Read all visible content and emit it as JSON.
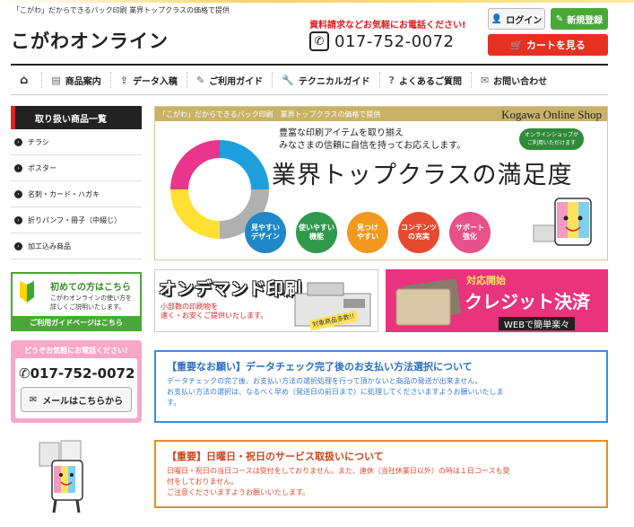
{
  "header": {
    "tagline": "「こがわ」だからできるパック印刷 業界トップクラスの価格で提供",
    "logo": "こがわオンライン",
    "request_text": "資料請求などお気軽にお電話ください!",
    "phone": "017-752-0072",
    "login_label": "ログイン",
    "signup_label": "新規登録",
    "cart_label": "カートを見る"
  },
  "nav": {
    "items": [
      {
        "label": "",
        "icon": "home-icon"
      },
      {
        "label": "商品案内",
        "icon": "document-icon"
      },
      {
        "label": "データ入稿",
        "icon": "upload-icon"
      },
      {
        "label": "ご利用ガイド",
        "icon": "pencil-icon"
      },
      {
        "label": "テクニカルガイド",
        "icon": "wrench-icon"
      },
      {
        "label": "よくあるご質問",
        "icon": "question-icon"
      },
      {
        "label": "お問い合わせ",
        "icon": "mail-icon"
      }
    ]
  },
  "sidebar": {
    "heading": "取り扱い商品一覧",
    "items": [
      {
        "label": "チラシ"
      },
      {
        "label": "ポスター"
      },
      {
        "label": "名刺・カード・ハガキ"
      },
      {
        "label": "折りパンフ・冊子（中綴じ）"
      },
      {
        "label": "加工込み商品"
      }
    ],
    "guide": {
      "title": "初めての方はこちら",
      "desc1": "こがわオンラインの使い方を",
      "desc2": "詳しくご説明いたします。",
      "button": "ご利用ガイドページはこちら"
    },
    "contact": {
      "title": "どうぞお気軽にお電話ください!",
      "phone": "017-752-0072",
      "mail_button": "メールはこちらから"
    }
  },
  "hero": {
    "strip_left": "「こがわ」だからできるパック印刷　業界トップクラスの価格で提供",
    "strip_right": "Kogawa Online Shop",
    "line1": "豊富な印刷アイテムを取り揃え",
    "line2": "みなさまの信頼に自信を持ってお応えします。",
    "headline": "業界トップクラスの満足度",
    "badge": "オンラインショップが\nご利用いただけます",
    "circles": [
      {
        "label": "見やすい\nデザイン",
        "color": "#1e88c8"
      },
      {
        "label": "使いやすい\n機能",
        "color": "#2f9a4a"
      },
      {
        "label": "見つけ\nやすい",
        "color": "#f39a1e"
      },
      {
        "label": "コンテンツ\nの充実",
        "color": "#e64a2e"
      },
      {
        "label": "サポート\n強化",
        "color": "#e8508a"
      }
    ]
  },
  "promos": {
    "ondemand": {
      "title": "オンデマンド印刷",
      "sub1": "小部数の印刷物を",
      "sub2": "速く・お安くご提供いたします。",
      "stamp": "対象商品多数!!"
    },
    "credit": {
      "t1": "対応開始",
      "t2": "クレジット決済",
      "t3": "WEBで簡単楽々"
    }
  },
  "notices": [
    {
      "title": "【重要なお願い】データチェック完了後のお支払い方法選択について",
      "lines": [
        "データチェックの完了後、お支払い方法の選択処理を行って頂かないと商品の発送が出来ません。",
        "お支払い方法の選択は、なるべく早め（発送日の前日まで）に処理してくださいますようお願いいたしま",
        "す。"
      ]
    },
    {
      "title": "【重要】日曜日・祝日のサービス取扱いについて",
      "lines": [
        "日曜日・祝日の当日コースは受付をしておりません。また、連休（当社休業日以外）の時は１日コースも受",
        "付をしておりません。",
        "ご注意くださいますようお願いいたします。"
      ]
    }
  ]
}
